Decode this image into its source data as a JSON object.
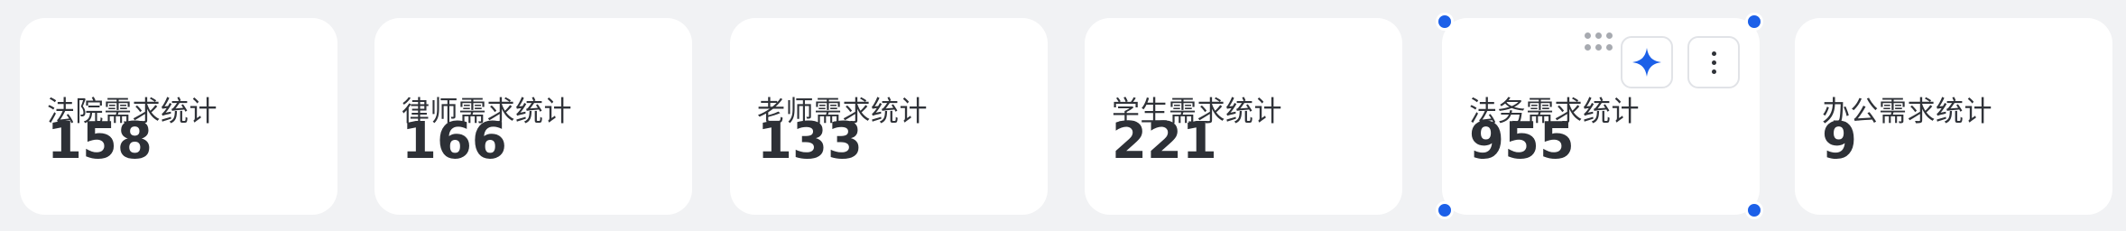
{
  "cards": [
    {
      "label": "法院需求统计",
      "value": "158"
    },
    {
      "label": "律师需求统计",
      "value": "166"
    },
    {
      "label": "老师需求统计",
      "value": "133"
    },
    {
      "label": "学生需求统计",
      "value": "221"
    },
    {
      "label": "法务需求统计",
      "value": "955"
    },
    {
      "label": "办公需求统计",
      "value": "9"
    }
  ],
  "colors": {
    "background": "#f1f2f4",
    "card": "#ffffff",
    "selection_handle": "#1c60e8",
    "ai_accent": "#1c60e8",
    "text": "#2f3238"
  },
  "toolbar": {
    "ai_icon": "sparkle-icon",
    "more_icon": "more-vertical-icon",
    "drag_icon": "drag-grip-icon"
  }
}
